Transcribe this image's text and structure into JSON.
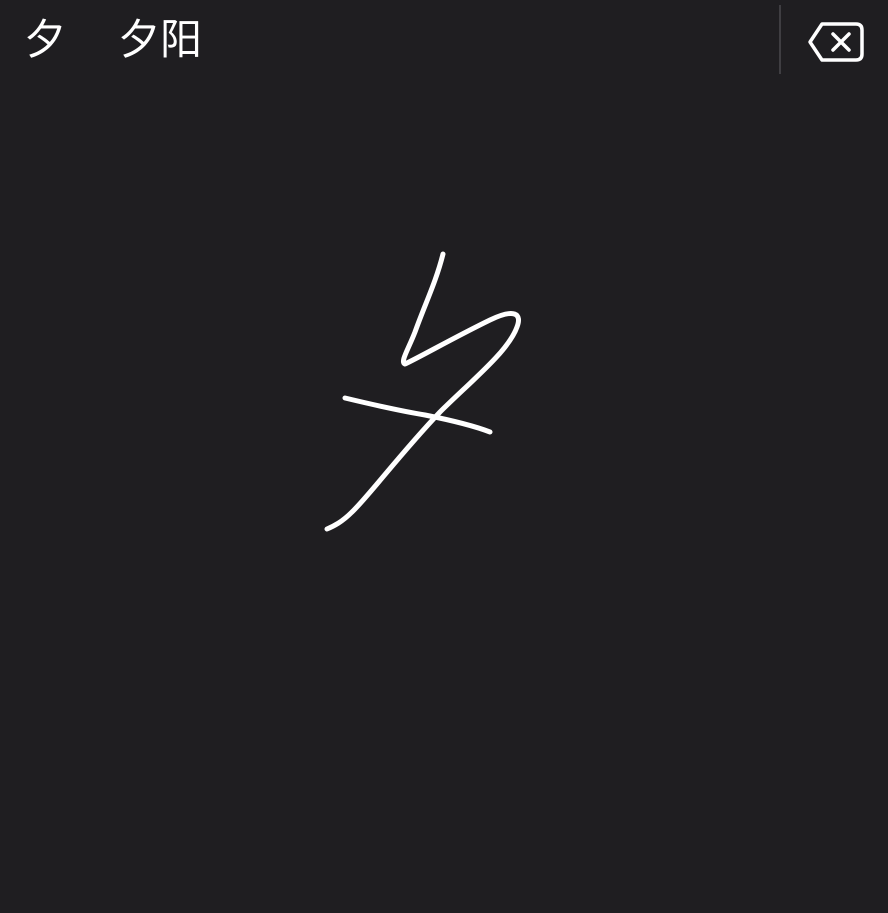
{
  "candidates": [
    {
      "label": "夕"
    },
    {
      "label": "夕阳"
    }
  ],
  "delete_key": {
    "icon": "delete-backward-icon"
  },
  "colors": {
    "background": "#1f1e21",
    "ink": "#ffffff",
    "divider": "#3f3e42"
  }
}
